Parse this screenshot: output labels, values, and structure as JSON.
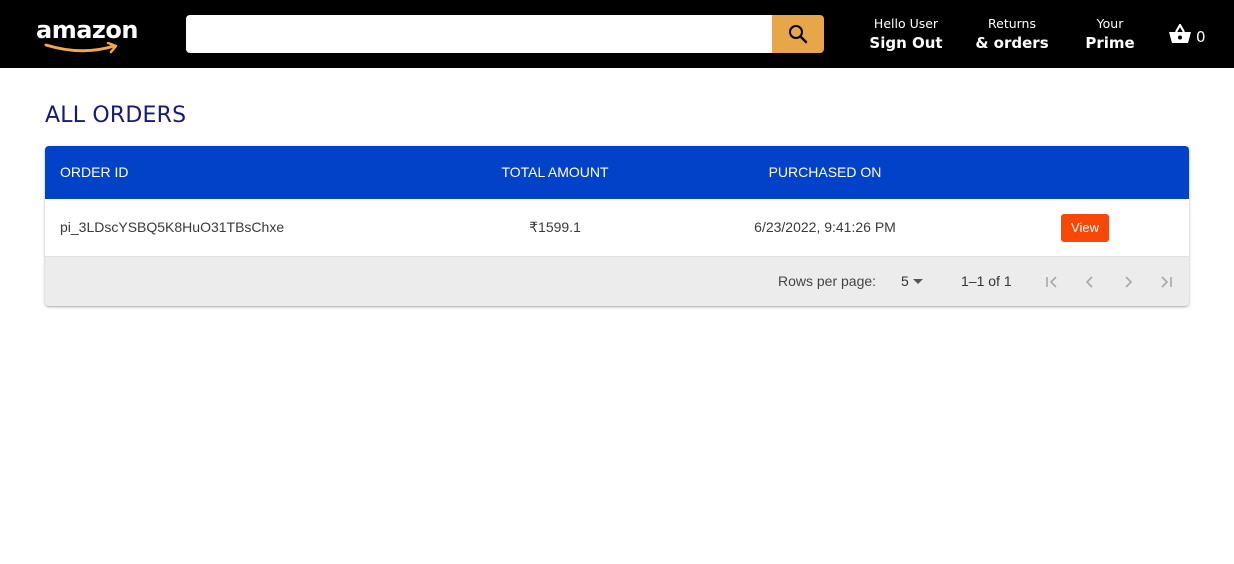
{
  "header": {
    "logo_text": "amazon",
    "search": {
      "value": "",
      "placeholder": ""
    },
    "greeting": "Hello User",
    "sign_out": "Sign Out",
    "returns": "Returns",
    "orders": "& orders",
    "your": "Your",
    "prime": "Prime",
    "basket_count": "0"
  },
  "colors": {
    "header_bg": "#000000",
    "search_button": "#e7a748",
    "title": "#131a7a",
    "table_header": "#0242c8",
    "view_button": "#f84808"
  },
  "icons": {
    "search": "search-icon",
    "basket": "basket-icon",
    "first_page": "first-page-icon",
    "prev_page": "chevron-left-icon",
    "next_page": "chevron-right-icon",
    "last_page": "last-page-icon"
  },
  "page": {
    "title": "ALL ORDERS"
  },
  "table": {
    "columns": [
      "ORDER ID",
      "TOTAL AMOUNT",
      "PURCHASED ON"
    ],
    "rows": [
      {
        "order_id": "pi_3LDscYSBQ5K8HuO31TBsChxe",
        "total_amount": "₹1599.1",
        "purchased_on": "6/23/2022, 9:41:26 PM",
        "action": "View"
      }
    ],
    "footer": {
      "rows_per_page_label": "Rows per page:",
      "rows_per_page": "5",
      "range": "1–1 of 1"
    }
  }
}
